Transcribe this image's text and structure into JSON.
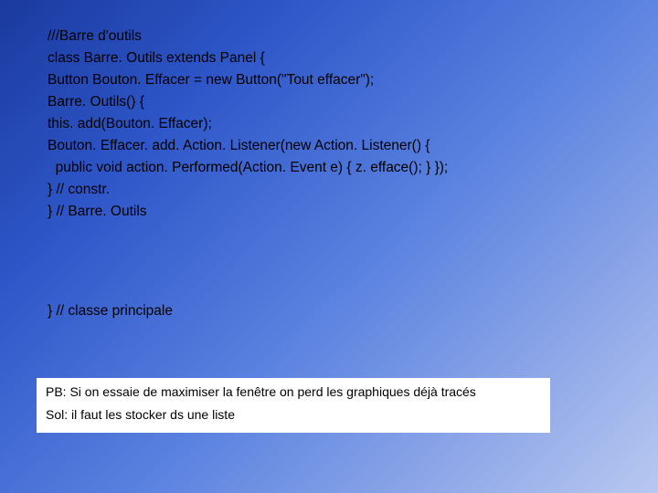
{
  "code": {
    "l1": "///Barre d'outils",
    "l2": "class Barre. Outils extends Panel {",
    "l3": "Button Bouton. Effacer = new Button(\"Tout effacer\");",
    "l4": "Barre. Outils() {",
    "l5": "this. add(Bouton. Effacer);",
    "l6": "Bouton. Effacer. add. Action. Listener(new Action. Listener() {",
    "l7": "  public void action. Performed(Action. Event e) { z. efface(); } });",
    "l8": "} // constr.",
    "l9": "} // Barre. Outils"
  },
  "closing": "} // classe principale",
  "note": {
    "pb": "PB: Si on essaie de maximiser la fenêtre on perd les graphiques déjà tracés",
    "sol": "Sol: il faut les stocker ds une liste"
  }
}
